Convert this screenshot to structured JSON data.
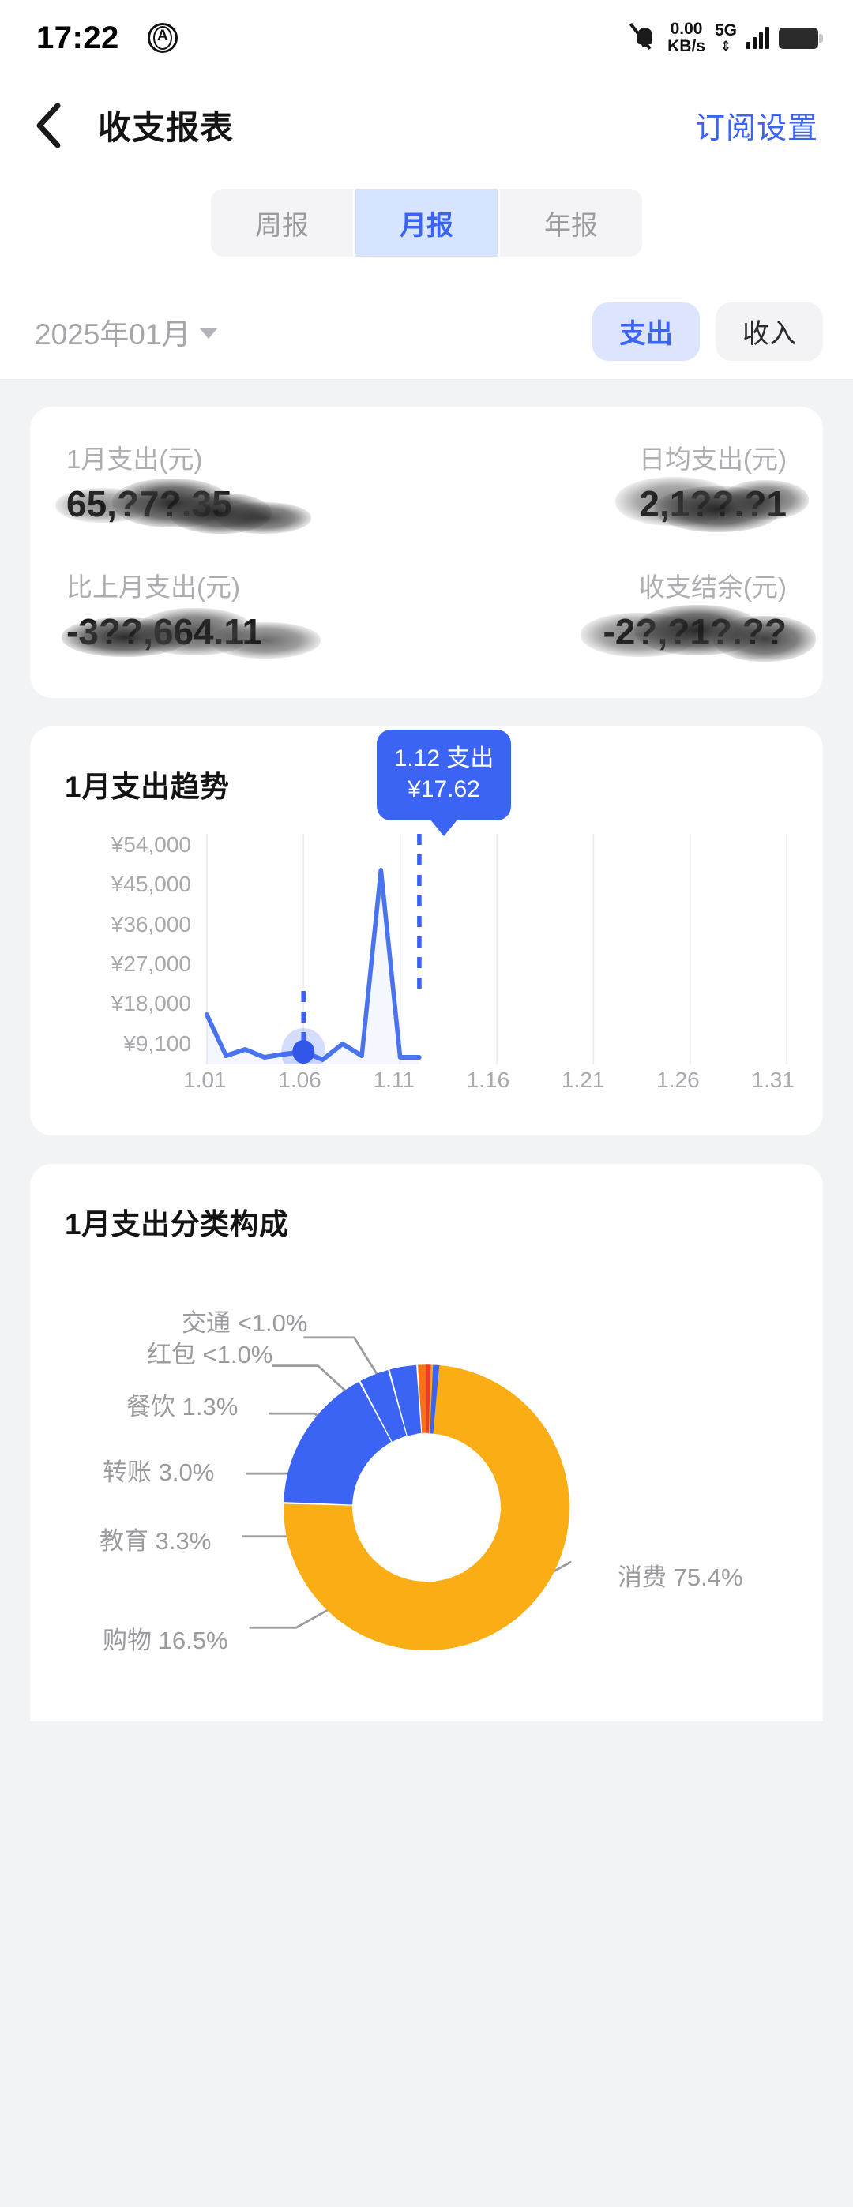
{
  "statusbar": {
    "time": "17:22",
    "app_icon": "airplane-badge-icon",
    "mute_icon": "bell-muted-icon",
    "network_rate": "0.00",
    "network_unit": "KB/s",
    "network_type": "5G",
    "signal_icon": "signal-bars-icon",
    "battery_icon": "battery-full-icon"
  },
  "nav": {
    "back_icon": "chevron-left-icon",
    "title": "收支报表",
    "action_label": "订阅设置"
  },
  "tabs": [
    {
      "label": "周报",
      "active": false
    },
    {
      "label": "月报",
      "active": true
    },
    {
      "label": "年报",
      "active": false
    }
  ],
  "filter": {
    "month_label": "2025年01月",
    "month_chevron": "chevron-down-icon",
    "type_pills": [
      {
        "label": "支出",
        "active": true
      },
      {
        "label": "收入",
        "active": false
      }
    ]
  },
  "summary": {
    "cells": [
      {
        "label": "1月支出(元)",
        "value": "65,?7?.35",
        "redacted": true
      },
      {
        "label": "日均支出(元)",
        "value": "2,1??.?1",
        "redacted": true
      },
      {
        "label": "比上月支出(元)",
        "value": "-3??,664.11",
        "redacted": true
      },
      {
        "label": "收支结余(元)",
        "value": "-2?,?1?.??",
        "redacted": true
      }
    ]
  },
  "trend_card": {
    "title": "1月支出趋势",
    "tooltip": {
      "line1": "1.12 支出",
      "line2": "¥17.62"
    }
  },
  "category_card": {
    "title": "1月支出分类构成"
  },
  "colors": {
    "accent_blue": "#3b64f5",
    "tab_active_bg": "#d6e4ff",
    "pill_active_bg": "#dde4fe",
    "amber": "#fbad15",
    "orange": "#f97316",
    "red": "#ef3b2c",
    "blue": "#3b64f5",
    "page_bg": "#f2f3f5",
    "card_bg": "#ffffff",
    "muted_text": "#a8a8ad"
  },
  "chart_data": [
    {
      "type": "line",
      "title": "1月支出趋势",
      "xlabel": "",
      "ylabel": "",
      "ylim": [
        0,
        54000
      ],
      "ytick_labels": [
        "¥54,000",
        "¥45,000",
        "¥36,000",
        "¥27,000",
        "¥18,000",
        "¥9,100"
      ],
      "ytick_values": [
        54000,
        45000,
        36000,
        27000,
        18000,
        9100
      ],
      "xtick_labels": [
        "1.01",
        "1.06",
        "1.11",
        "1.16",
        "1.21",
        "1.26",
        "1.31"
      ],
      "grid": "vertical",
      "legend": "none",
      "x": [
        "1.01",
        "1.02",
        "1.03",
        "1.04",
        "1.05",
        "1.06",
        "1.07",
        "1.08",
        "1.09",
        "1.10",
        "1.11",
        "1.12"
      ],
      "values": [
        10200,
        400,
        1400,
        700,
        900,
        1100,
        200,
        2600,
        500,
        50000,
        600,
        700
      ],
      "highlight_point": {
        "x": "1.06",
        "value": 1100
      },
      "annotation": {
        "x": "1.12",
        "label": "1.12 支出",
        "value": "¥17.62"
      }
    },
    {
      "type": "pie",
      "subtype": "donut",
      "title": "1月支出分类构成",
      "labels": [
        "消费",
        "购物",
        "教育",
        "转账",
        "餐饮",
        "红包",
        "交通"
      ],
      "display_labels": [
        "消费 75.4%",
        "购物 16.5%",
        "教育 3.3%",
        "转账 3.0%",
        "餐饮 1.3%",
        "红包 <1.0%",
        "交通 <1.0%"
      ],
      "values": [
        75.4,
        16.5,
        3.3,
        3.0,
        1.3,
        0.8,
        0.7
      ],
      "unit": "%",
      "slice_colors": [
        "#fbad15",
        "#3b64f5",
        "#3b64f5",
        "#3b64f5",
        "#f97316",
        "#ef3b2c",
        "#3b64f5"
      ],
      "start_angle": 0,
      "direction": "clockwise",
      "legend": "callout-labels"
    }
  ]
}
